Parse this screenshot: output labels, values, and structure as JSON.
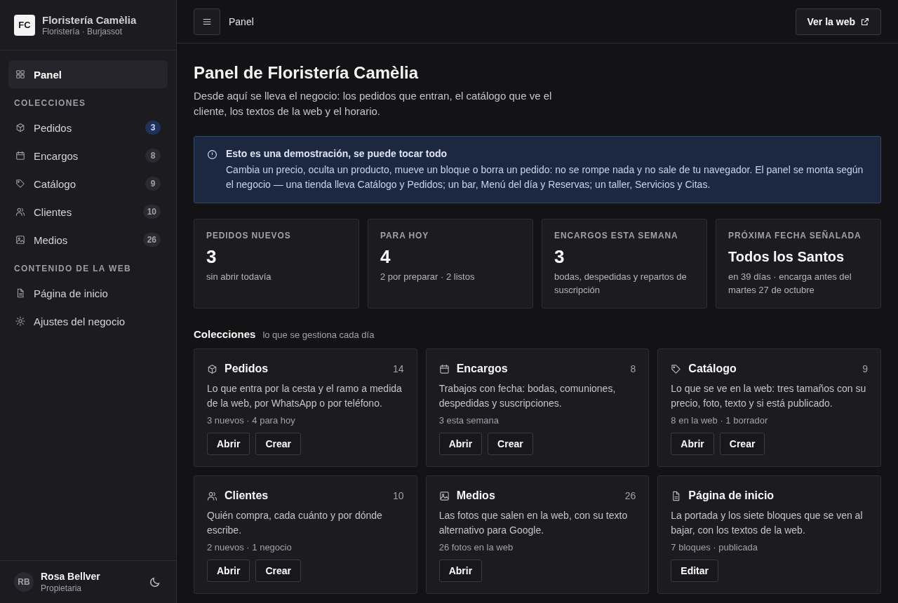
{
  "brand": {
    "initials": "FC",
    "name": "Floristería Camèlia",
    "subtitle": "Floristería · Burjassot"
  },
  "sidebar": {
    "top_item": {
      "label": "Panel",
      "selected": true
    },
    "sections": [
      {
        "title": "COLECCIONES",
        "items": [
          {
            "label": "Pedidos",
            "count": "3",
            "highlight": true,
            "selected": false
          },
          {
            "label": "Encargos",
            "count": "8",
            "highlight": false,
            "selected": false
          },
          {
            "label": "Catálogo",
            "count": "9",
            "highlight": false,
            "selected": false
          },
          {
            "label": "Clientes",
            "count": "10",
            "highlight": false,
            "selected": false
          },
          {
            "label": "Medios",
            "count": "26",
            "highlight": false,
            "selected": false
          }
        ]
      },
      {
        "title": "CONTENIDO DE LA WEB",
        "items": [
          {
            "label": "Página de inicio",
            "selected": false
          },
          {
            "label": "Ajustes del negocio",
            "selected": false
          }
        ]
      }
    ],
    "user": {
      "initials": "RB",
      "name": "Rosa Bellver",
      "role": "Propietaria"
    }
  },
  "topbar": {
    "breadcrumb": "Panel",
    "button": "Ver la web"
  },
  "page": {
    "title": "Panel de Floristería Camèlia",
    "description": "Desde aquí se lleva el negocio: los pedidos que entran, el catálogo que ve el cliente, los textos de la web y el horario."
  },
  "notice": {
    "title": "Esto es una demostración, se puede tocar todo",
    "text": "Cambia un precio, oculta un producto, mueve un bloque o borra un pedido: no se rompe nada y no sale de tu navegador. El panel se monta según el negocio — una tienda lleva Catálogo y Pedidos; un bar, Menú del día y Reservas; un taller, Servicios y Citas."
  },
  "stats": [
    {
      "label": "PEDIDOS NUEVOS",
      "value": "3",
      "note": "sin abrir todavía"
    },
    {
      "label": "PARA HOY",
      "value": "4",
      "note": "2 por preparar · 2 listos"
    },
    {
      "label": "ENCARGOS ESTA SEMANA",
      "value": "3",
      "note": "bodas, despedidas y repartos de suscripción"
    },
    {
      "label": "PRÓXIMA FECHA SEÑALADA",
      "value": "Todos los Santos",
      "note": "en 39 días · encarga antes del martes 27 de octubre"
    }
  ],
  "collections": {
    "title": "Colecciones",
    "subtitle": "lo que se gestiona cada día",
    "cards": [
      {
        "title": "Pedidos",
        "count": "14",
        "description": "Lo que entra por la cesta y el ramo a medida de la web, por WhatsApp o por teléfono.",
        "meta": "3 nuevos · 4 para hoy",
        "buttons": [
          "Abrir",
          "Crear"
        ]
      },
      {
        "title": "Encargos",
        "count": "8",
        "description": "Trabajos con fecha: bodas, comuniones, despedidas y suscripciones.",
        "meta": "3 esta semana",
        "buttons": [
          "Abrir",
          "Crear"
        ]
      },
      {
        "title": "Catálogo",
        "count": "9",
        "description": "Lo que se ve en la web: tres tamaños con su precio, foto, texto y si está publicado.",
        "meta": "8 en la web · 1 borrador",
        "buttons": [
          "Abrir",
          "Crear"
        ]
      },
      {
        "title": "Clientes",
        "count": "10",
        "description": "Quién compra, cada cuánto y por dónde escribe.",
        "meta": "2 nuevos · 1 negocio",
        "buttons": [
          "Abrir",
          "Crear"
        ]
      },
      {
        "title": "Medios",
        "count": "26",
        "description": "Las fotos que salen en la web, con su texto alternativo para Google.",
        "meta": "26 fotos en la web",
        "buttons": [
          "Abrir"
        ]
      },
      {
        "title": "Página de inicio",
        "description": "La portada y los siete bloques que se ven al bajar, con los textos de la web.",
        "meta": "7 bloques · publicada",
        "buttons": [
          "Editar"
        ]
      }
    ]
  }
}
